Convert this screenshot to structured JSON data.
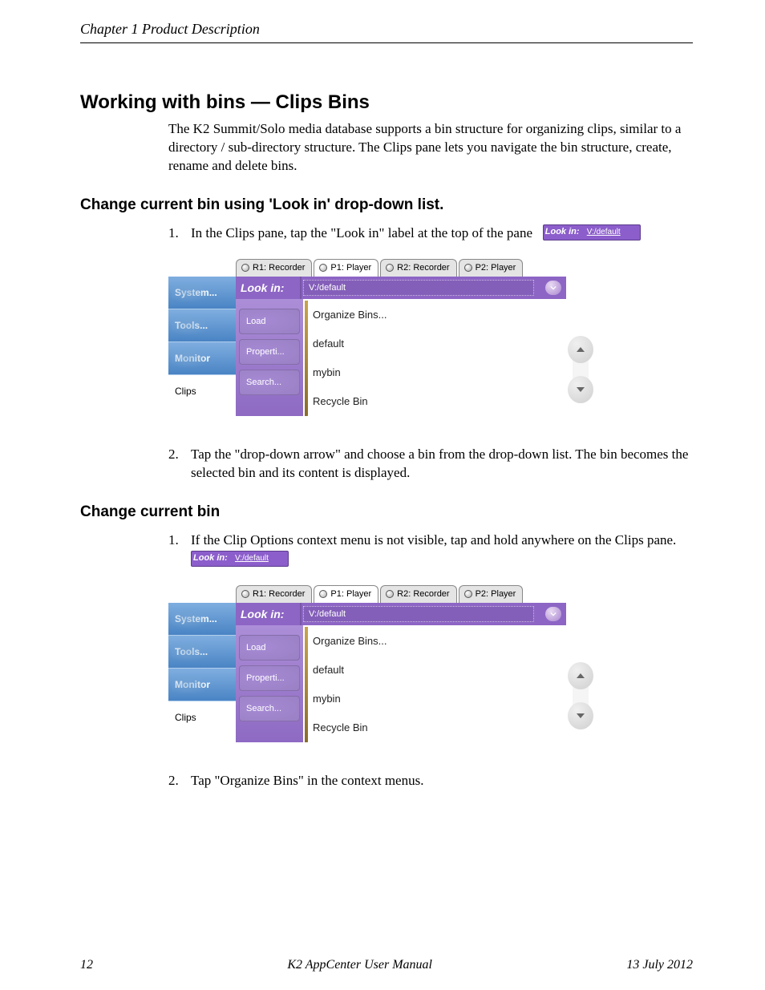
{
  "header": {
    "left": "Chapter 1   Product Description",
    "right": ""
  },
  "title": "Working with bins — Clips Bins",
  "intro": "The K2 Summit/Solo media database supports a bin structure for organizing clips, similar to a directory / sub-directory structure. The Clips pane lets you navigate the bin structure, create, rename and delete bins.",
  "section2": {
    "title": "Change current bin using 'Look in' drop-down list.",
    "steps": [
      "In the Clips pane, tap the \"Look in\" label at the top of the pane",
      "Tap the \"drop-down arrow\" and choose a bin from the drop-down list. The bin becomes the selected bin and its content is displayed."
    ]
  },
  "section3": {
    "title": "Change current bin",
    "steps": [
      "If the Clip Options context menu is not visible, tap and hold anywhere on the Clips pane.",
      "Tap \"Organize Bins\" in the context menus."
    ]
  },
  "lookin": {
    "label": "Look in:",
    "value": "V:/default"
  },
  "figure": {
    "tabs": [
      {
        "label": "R1: Recorder",
        "active": false
      },
      {
        "label": "P1: Player",
        "active": true
      },
      {
        "label": "R2: Recorder",
        "active": false
      },
      {
        "label": "P2: Player",
        "active": false
      }
    ],
    "sidenav": [
      "System...",
      "Tools...",
      "Monitor",
      "Clips"
    ],
    "lookin_label": "Look in:",
    "lookin_value": "V:/default",
    "actions": [
      "Load",
      "Properti...",
      "Search..."
    ],
    "list": [
      "Organize Bins...",
      "default",
      "mybin",
      "Recycle Bin"
    ]
  },
  "footer": {
    "left": "12",
    "center": "K2 AppCenter User Manual",
    "right": "13 July 2012"
  }
}
